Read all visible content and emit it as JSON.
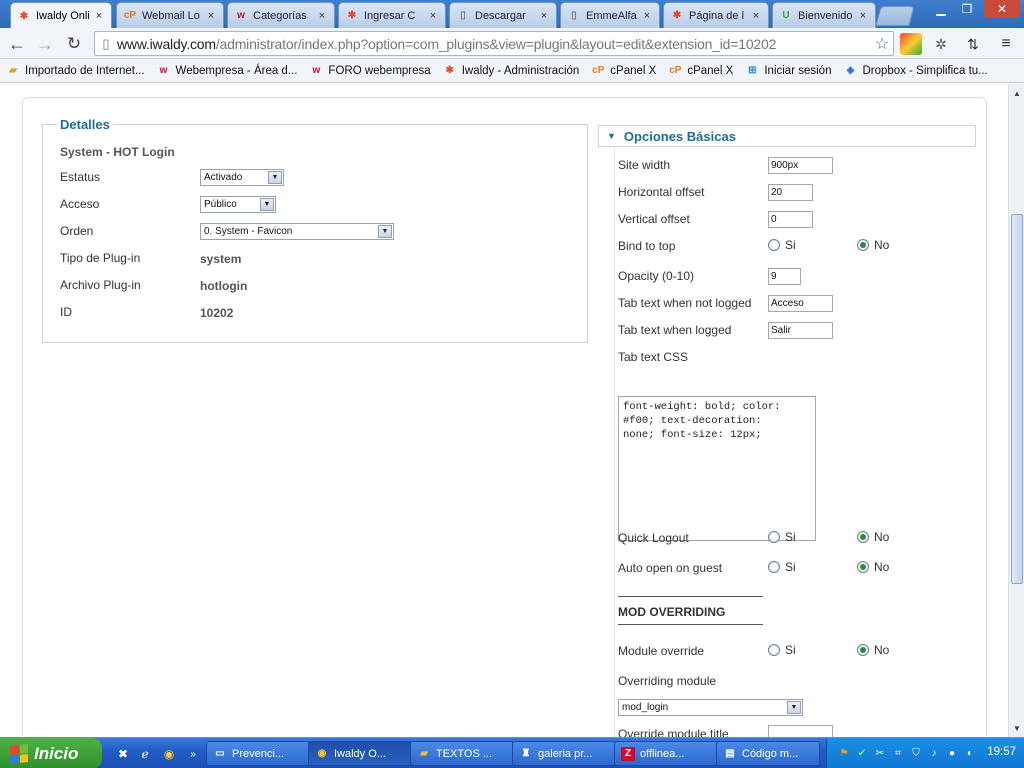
{
  "browser": {
    "tabs": [
      {
        "label": "Iwaldy Onli",
        "icon": "joomla-icon",
        "active": true
      },
      {
        "label": "Webmail Lo",
        "icon": "cpanel-icon"
      },
      {
        "label": "Categorías",
        "icon": "webempresa-icon"
      },
      {
        "label": "Ingresar C",
        "icon": "joomla-icon"
      },
      {
        "label": "Descargar",
        "icon": "page-icon"
      },
      {
        "label": "EmmeAlfa",
        "icon": "page-icon"
      },
      {
        "label": "Página de l",
        "icon": "joomla-icon"
      },
      {
        "label": "Bienvenido",
        "icon": "u-icon"
      }
    ],
    "close_glyph": "×",
    "address": {
      "host": "www.iwaldy.com",
      "path": "/administrator/index.php?option=com_plugins&view=plugin&layout=edit&extension_id=10202"
    },
    "bookmarks": [
      {
        "label": "Importado de Internet...",
        "icon": "folder-icon"
      },
      {
        "label": "Webempresa - Área d...",
        "icon": "webempresa-icon"
      },
      {
        "label": "FORO webempresa",
        "icon": "webempresa-icon"
      },
      {
        "label": "Iwaldy - Administración",
        "icon": "joomla-icon"
      },
      {
        "label": "cPanel X",
        "icon": "cpanel-icon"
      },
      {
        "label": "cPanel X",
        "icon": "cpanel-icon"
      },
      {
        "label": "Iniciar sesión",
        "icon": "windows-icon"
      },
      {
        "label": "Dropbox - Simplifica tu...",
        "icon": "dropbox-icon"
      }
    ]
  },
  "details": {
    "legend": "Detalles",
    "plugin_name": "System - HOT Login",
    "estatus_label": "Estatus",
    "estatus_value": "Activado",
    "acceso_label": "Acceso",
    "acceso_value": "Público",
    "orden_label": "Orden",
    "orden_value": "0. System - Favicon",
    "tipo_label": "Tipo de Plug-in",
    "tipo_value": "system",
    "archivo_label": "Archivo Plug-in",
    "archivo_value": "hotlogin",
    "id_label": "ID",
    "id_value": "10202"
  },
  "options": {
    "header": "Opciones Básicas",
    "site_width_label": "Site width",
    "site_width_value": "900px",
    "h_offset_label": "Horizontal offset",
    "h_offset_value": "20",
    "v_offset_label": "Vertical offset",
    "v_offset_value": "0",
    "bind_top_label": "Bind to top",
    "opacity_label": "Opacity (0-10)",
    "opacity_value": "9",
    "tab_not_logged_label": "Tab text when not logged",
    "tab_not_logged_value": "Acceso",
    "tab_logged_label": "Tab text when logged",
    "tab_logged_value": "Salir",
    "tab_css_label": "Tab text CSS",
    "tab_css_value": "font-weight: bold; color:\n#f00; text-decoration:\nnone; font-size: 12px;",
    "quick_logout_label": "Quick Logout",
    "auto_open_label": "Auto open on guest",
    "mod_overriding_heading": "MOD OVERRIDING",
    "module_override_label": "Module override",
    "overriding_module_label": "Overriding module",
    "overriding_module_value": "mod_login",
    "override_title_label": "Override module title",
    "yes_label": "Si",
    "no_label": "No"
  },
  "taskbar": {
    "start_label": "Inicio",
    "items": [
      {
        "label": "Prevenci...",
        "icon": "window-icon"
      },
      {
        "label": "Iwaldy O...",
        "icon": "chrome-icon",
        "active": true
      },
      {
        "label": "TEXTOS ...",
        "icon": "folder-icon"
      },
      {
        "label": "galeria pr...",
        "icon": "app-icon"
      },
      {
        "label": "offlinea...",
        "icon": "filezilla-icon"
      },
      {
        "label": "Código m...",
        "icon": "notepad-icon"
      }
    ],
    "clock": "19:57"
  }
}
